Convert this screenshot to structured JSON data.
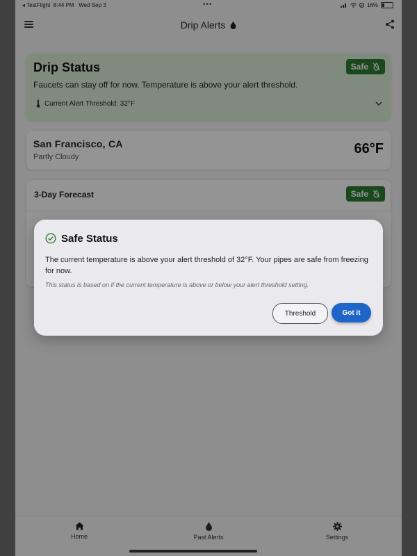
{
  "status_bar": {
    "carrier": "◂ TestFlight",
    "time": "8:44 PM",
    "date": "Wed Sep 3",
    "dots": "•••",
    "battery": "16%"
  },
  "header": {
    "title": "Drip Alerts"
  },
  "drip_status": {
    "title": "Drip Status",
    "badge": "Safe",
    "description": "Faucets can stay off for now. Temperature is above your alert threshold.",
    "threshold": "Current Alert Threshold: 32°F"
  },
  "location": {
    "name": "San Francisco, CA",
    "condition": "Partly Cloudy",
    "temperature": "66°F"
  },
  "forecast": {
    "title": "3-Day Forecast",
    "badge": "Safe"
  },
  "dialog": {
    "title": "Safe Status",
    "body": "The current temperature is above your alert threshold of 32°F. Your pipes are safe from freezing for now.",
    "note": "This status is based on if the current temperature is above or below your alert threshold setting.",
    "threshold_button": "Threshold",
    "confirm_button": "Got it"
  },
  "bottom_nav": {
    "items": [
      {
        "label": "Home",
        "icon": "home-icon"
      },
      {
        "label": "Past Alerts",
        "icon": "drop-icon"
      },
      {
        "label": "Settings",
        "icon": "gear-icon"
      }
    ]
  },
  "colors": {
    "safe_green": "#2e7d32",
    "status_card_bg": "#dff0d8",
    "primary_blue": "#1f64c8"
  }
}
